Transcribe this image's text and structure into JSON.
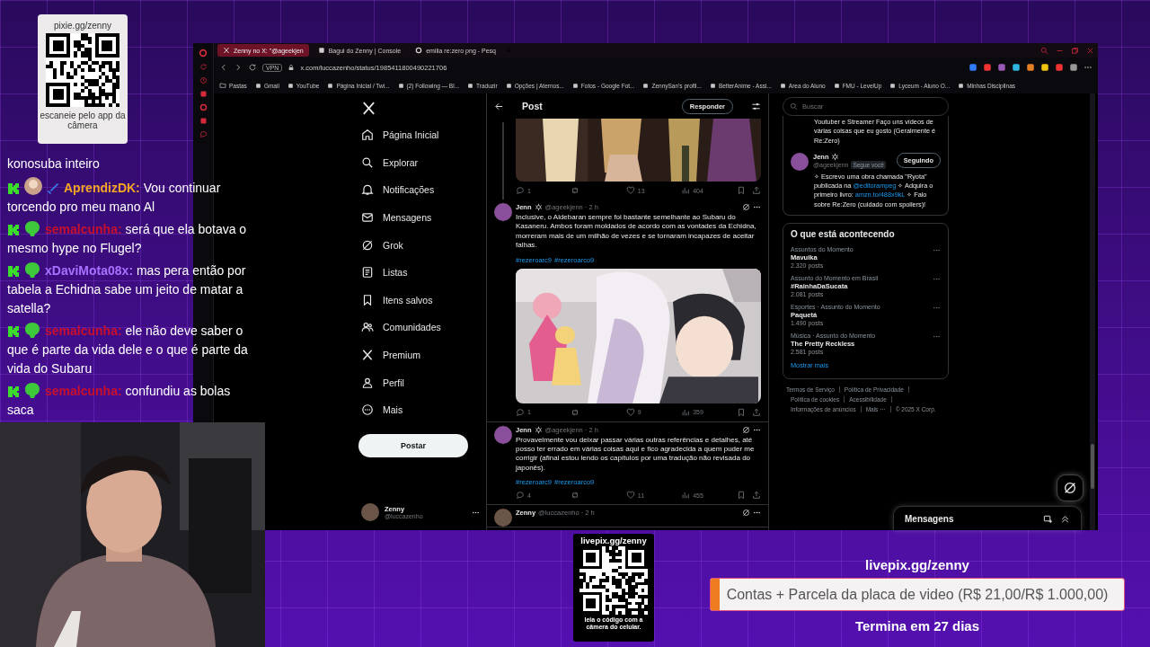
{
  "donation_qr": {
    "title": "pixie.gg/zenny",
    "caption": "escaneie pelo app da câmera"
  },
  "chat": [
    {
      "kind": "plain",
      "text": "konosuba inteiro"
    },
    {
      "kind": "avatar",
      "user": "AprendizDK:",
      "color": "#f5a623",
      "text": "Vou continuar torcendo pro meu mano Al"
    },
    {
      "kind": "emote",
      "user": "semalcunha:",
      "color": "#c8102e",
      "text": "será que ela botava o mesmo hype no Flugel?"
    },
    {
      "kind": "emote",
      "user": "xDaviMota08x:",
      "color": "#a970ff",
      "text": "mas pera então por tabela a Echidna sabe um jeito de matar a satella?"
    },
    {
      "kind": "emote",
      "user": "semalcunha:",
      "color": "#c8102e",
      "text": "ele não deve saber o que é parte da vida dele e o que é parte da vida do Subaru"
    },
    {
      "kind": "emote",
      "user": "semalcunha:",
      "color": "#c8102e",
      "text": "confundiu as bolas saca"
    }
  ],
  "browser": {
    "tabs": [
      {
        "label": "Zenny no X: \"@ageekjen",
        "selected": true
      },
      {
        "label": "Bagui do Zenny | Console",
        "selected": false
      },
      {
        "label": "emilia re:zero png - Pesq",
        "selected": false
      }
    ],
    "vpn": "VPN",
    "url": "x.com/luccazenho/status/1985411800490221706",
    "bookmarks": [
      "Pastas",
      "Gmail",
      "YouTube",
      "Página Inicial / Twi...",
      "(2) Following — Bl...",
      "Traduzir",
      "Opções | Aternos...",
      "Fotos - Google Fot...",
      "ZennySan's profil...",
      "BetterAnime - Assi...",
      "Area do Aluno",
      "FMU - LevelUp",
      "Lyceum - Aluno O...",
      "Minhas Disciplinas"
    ]
  },
  "x": {
    "nav": [
      "Página Inicial",
      "Explorar",
      "Notificações",
      "Mensagens",
      "Grok",
      "Listas",
      "Itens salvos",
      "Comunidades",
      "Premium",
      "Perfil",
      "Mais"
    ],
    "post_button": "Postar",
    "account": {
      "name": "Zenny",
      "handle": "@luccazenho"
    },
    "header": {
      "title": "Post",
      "reply_button": "Responder"
    },
    "posts": [
      {
        "media": {
          "kind": "picture"
        },
        "stats": {
          "replies": "1",
          "likes": "13",
          "views": "404"
        }
      },
      {
        "author": "Jenn",
        "meta": "@ageekjenn · 2 h",
        "text": "Inclusive, o Aldebaran sempre foi bastante semelhante ao Subaru do Kasaneru. Ambos foram moldados de acordo com as vontades da Echidna, morreram mais de um milhão de vezes e se tornaram incapazes de aceitar falhas.",
        "hashtags": [
          "#rezeroarc9",
          "#rezeroarco9"
        ],
        "media": {
          "kind": "picture"
        },
        "stats": {
          "replies": "1",
          "likes": "9",
          "views": "359"
        }
      },
      {
        "author": "Jenn",
        "meta": "@ageekjenn · 2 h",
        "text": "Provavelmente vou deixar passar várias outras referências e detalhes, até posso ter errado em várias coisas aqui e fico agradecida a quem puder me corrigir (afinal estou lendo os capítulos por uma tradução não revisada do japonês).",
        "hashtags": [
          "#rezeroarc9",
          "#rezeroarco9"
        ],
        "stats": {
          "replies": "4",
          "likes": "11",
          "views": "455"
        }
      },
      {
        "author": "Zenny",
        "meta": "@luccazenho · 2 h"
      }
    ],
    "search": {
      "placeholder": "Buscar"
    },
    "profile_card": {
      "bio_cut": "Youtuber e Streamer Faço uns vídeos de várias coisas que eu gosto (Geralmente é Re:Zero)",
      "name": "Jenn",
      "handle": "@ageekjenn",
      "follows_you": "Segue você",
      "button": "Seguindo",
      "bio": [
        {
          "kind": "text",
          "text": "✧ Escrevo uma obra chamada \"Ryota\" publicada na "
        },
        {
          "kind": "link",
          "text": "@editorampeg"
        },
        {
          "kind": "text",
          "text": " ✧ Adquira o primeiro livro: "
        },
        {
          "kind": "link",
          "text": "amzn.to/488x9kL"
        },
        {
          "kind": "text",
          "text": " ✧ Falo sobre Re:Zero (cuidado com spoilers)!"
        }
      ]
    },
    "trends": {
      "title": "O que está acontecendo",
      "items": [
        {
          "context": "Assuntos do Momento",
          "topic": "Mavuika",
          "count": "2.320 posts"
        },
        {
          "context": "Assunto do Momento em Brasil",
          "topic": "#RainhaDaSucata",
          "count": "2.081 posts"
        },
        {
          "context": "Esportes · Assunto do Momento",
          "topic": "Paquetá",
          "count": "1.490 posts"
        },
        {
          "context": "Música · Assunto do Momento",
          "topic": "The Pretty Reckless",
          "count": "2.581 posts"
        }
      ],
      "more": "Mostrar mais"
    },
    "footer": [
      "Termos de Serviço",
      "Política de Privacidade",
      "Política de cookies",
      "Acessibilidade",
      "Informações de anúncios",
      "Mais ···",
      "© 2025 X Corp."
    ],
    "messages_drawer": {
      "title": "Mensagens"
    }
  },
  "livepix_qr": {
    "title": "livepix.gg/zenny",
    "caption": "leia o código com a câmera do celular."
  },
  "goal": {
    "url": "livepix.gg/zenny",
    "label": "Contas + Parcela da placa de video (R$ 21,00/R$ 1.000,00)",
    "level": 0.021,
    "ends": "Termina em 27 dias"
  }
}
